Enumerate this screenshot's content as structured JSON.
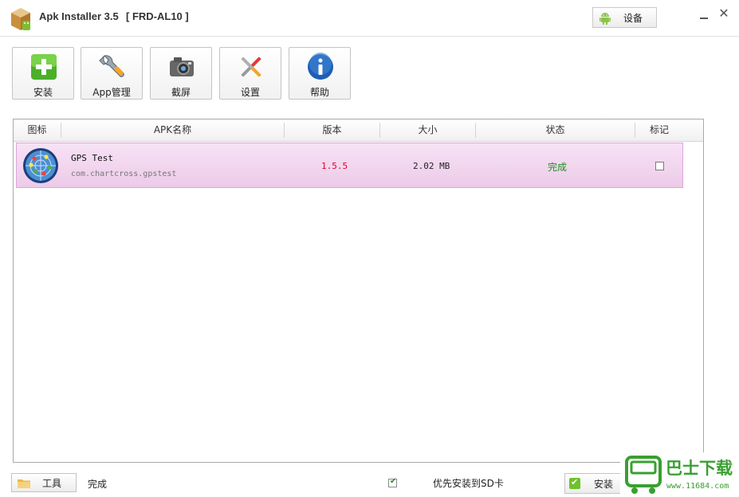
{
  "window": {
    "app_title": "Apk Installer 3.5",
    "device_name": "[ FRD-AL10 ]",
    "device_button_label": "设备"
  },
  "toolbar": {
    "buttons": [
      {
        "label": "安装",
        "icon": "install-plus-icon"
      },
      {
        "label": "App管理",
        "icon": "wrench-icon"
      },
      {
        "label": "截屏",
        "icon": "camera-icon"
      },
      {
        "label": "设置",
        "icon": "tools-icon"
      },
      {
        "label": "帮助",
        "icon": "info-icon"
      }
    ]
  },
  "list": {
    "columns": [
      "图标",
      "APK名称",
      "版本",
      "大小",
      "状态",
      "标记"
    ],
    "rows": [
      {
        "name": "GPS Test",
        "package": "com.chartcross.gpstest",
        "version": "1.5.5",
        "size": "2.02 MB",
        "status": "完成",
        "marked": false,
        "icon": "gps-radar-icon"
      }
    ]
  },
  "footer": {
    "tools_label": "工具",
    "status_text": "完成",
    "sd_option_label": "优先安装到SD卡",
    "sd_option_checked": true,
    "install_label": "安装"
  },
  "watermark": {
    "brand_text": "巴士下载",
    "url_text": "www.11684.com"
  },
  "colors": {
    "row_highlight": "#eccbe9",
    "version_red": "#e0002b",
    "status_green": "#1a8f1a",
    "brand_green": "#38a030"
  }
}
